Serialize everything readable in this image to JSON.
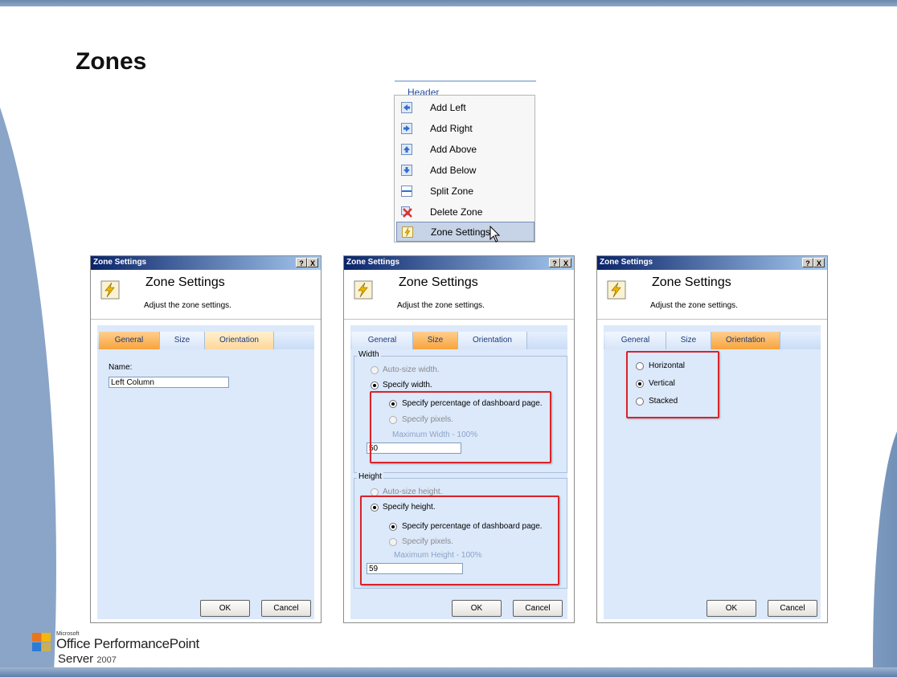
{
  "slide": {
    "title": "Zones"
  },
  "context_menu": {
    "header": "Header",
    "items": [
      {
        "label": "Add Left",
        "icon": "add-left-icon"
      },
      {
        "label": "Add Right",
        "icon": "add-right-icon"
      },
      {
        "label": "Add Above",
        "icon": "add-above-icon"
      },
      {
        "label": "Add Below",
        "icon": "add-below-icon"
      },
      {
        "label": "Split Zone",
        "icon": "split-zone-icon"
      },
      {
        "label": "Delete Zone",
        "icon": "delete-zone-icon"
      },
      {
        "label": "Zone Settings",
        "icon": "zone-settings-icon",
        "highlighted": true
      }
    ]
  },
  "dialogs": [
    {
      "window_title": "Zone Settings",
      "heading": "Zone Settings",
      "description": "Adjust the zone settings.",
      "help_button": "?",
      "close_button": "X",
      "tabs": [
        "General",
        "Size",
        "Orientation"
      ],
      "active_tab": "General",
      "name_label": "Name:",
      "name_value": "Left Column",
      "ok_label": "OK",
      "cancel_label": "Cancel"
    },
    {
      "window_title": "Zone Settings",
      "heading": "Zone Settings",
      "description": "Adjust the zone settings.",
      "help_button": "?",
      "close_button": "X",
      "tabs": [
        "General",
        "Size",
        "Orientation"
      ],
      "active_tab": "Size",
      "width": {
        "group_label": "Width",
        "auto_label": "Auto-size width.",
        "specify_label": "Specify width.",
        "percent_label": "Specify percentage of dashboard page.",
        "pixels_label": "Specify pixels.",
        "max_label": "Maximum Width - 100%",
        "value": "50"
      },
      "height": {
        "group_label": "Height",
        "auto_label": "Auto-size height.",
        "specify_label": "Specify height.",
        "percent_label": "Specify percentage of dashboard page.",
        "pixels_label": "Specify pixels.",
        "max_label": "Maximum Height - 100%",
        "value": "59"
      },
      "ok_label": "OK",
      "cancel_label": "Cancel"
    },
    {
      "window_title": "Zone Settings",
      "heading": "Zone Settings",
      "description": "Adjust the zone settings.",
      "help_button": "?",
      "close_button": "X",
      "tabs": [
        "General",
        "Size",
        "Orientation"
      ],
      "active_tab": "Orientation",
      "options": [
        "Horizontal",
        "Vertical",
        "Stacked"
      ],
      "selected_option": "Vertical",
      "ok_label": "OK",
      "cancel_label": "Cancel"
    }
  ],
  "logo": {
    "microsoft": "Microsoft",
    "product_line1": "Office PerformancePoint",
    "product_line2": "Server",
    "year": "2007"
  },
  "colors": {
    "frame_blue": "#8aa5c7",
    "titlebar_dark": "#0a246a",
    "active_tab": "#f7a33c",
    "panel_bg": "#dce9fb",
    "highlight_red": "#d9232a"
  }
}
